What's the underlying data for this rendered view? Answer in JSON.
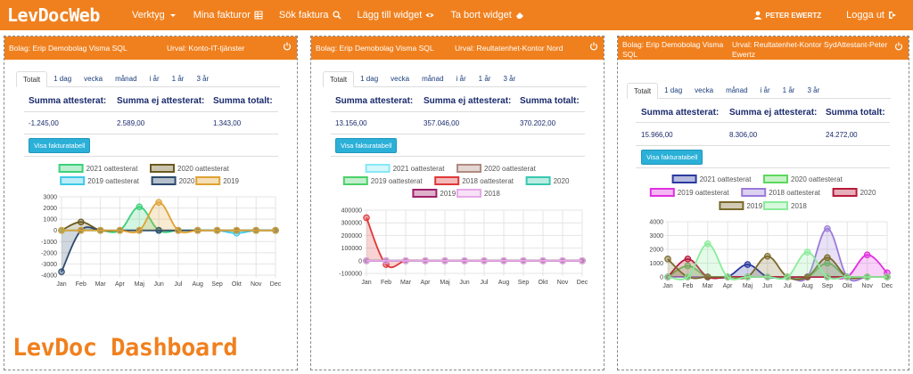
{
  "app": {
    "brand": "LevDocWeb",
    "dashboard_title": "LevDoc Dashboard"
  },
  "nav": {
    "items": [
      {
        "label": "Verktyg",
        "icon": "caret-down-icon"
      },
      {
        "label": "Mina fakturor",
        "icon": "table-icon"
      },
      {
        "label": "Sök faktura",
        "icon": "search-icon"
      },
      {
        "label": "Lägg till widget",
        "icon": "eye-icon"
      },
      {
        "label": "Ta bort widget",
        "icon": "eraser-icon"
      }
    ],
    "user": "PETER EWERTZ",
    "logout": "Logga ut"
  },
  "colors": {
    "accent": "#f0801e",
    "button": "#2bb0d8",
    "heading": "#1a2a6c"
  },
  "tabs": [
    "Totalt",
    "1 dag",
    "vecka",
    "månad",
    "i år",
    "1 år",
    "3 år"
  ],
  "labels": {
    "sum_attested": "Summa attesterat:",
    "sum_not_attested": "Summa ej attesterat:",
    "sum_total": "Summa totalt:",
    "show_table": "Visa fakturatabell"
  },
  "panels": [
    {
      "bolag": "Bolag: Erip Demobolag Visma SQL",
      "urval": "Urval: Konto-IT-tjänster",
      "attested": "-1.245,00",
      "not_attested": "2.589,00",
      "total": "1.343,00"
    },
    {
      "bolag": "Bolag: Erip Demobolag Visma SQL",
      "urval": "Urval: Reultatenhet-Kontor Nord",
      "attested": "13.156,00",
      "not_attested": "357.046,00",
      "total": "370.202,00"
    },
    {
      "bolag": "Bolag: Erip Demobolag Visma SQL",
      "urval": "Urval: Reultatenhet-Kontor SydAttestant-Peter Ewertz",
      "attested": "15.966,00",
      "not_attested": "8.306,00",
      "total": "24.272,00"
    }
  ],
  "chart_data": [
    {
      "type": "area",
      "categories": [
        "Jan",
        "Feb",
        "Mar",
        "Apr",
        "Maj",
        "Jun",
        "Jul",
        "Aug",
        "Sep",
        "Okt",
        "Nov",
        "Dec"
      ],
      "ylim": [
        -4000,
        3000
      ],
      "yticks": [
        3000,
        2000,
        1000,
        0,
        -1000,
        -2000,
        -3000,
        -4000
      ],
      "series": [
        {
          "name": "2021 oattesterat",
          "color": "#3dd07a",
          "values": [
            0,
            0,
            0,
            0,
            2100,
            0,
            0,
            0,
            0,
            0,
            0,
            0
          ]
        },
        {
          "name": "2020 oattesterat",
          "color": "#6b5a1e",
          "values": [
            0,
            750,
            0,
            0,
            0,
            0,
            0,
            0,
            0,
            0,
            0,
            0
          ]
        },
        {
          "name": "2019 oattesterat",
          "color": "#3fc9e8",
          "values": [
            0,
            0,
            0,
            0,
            0,
            0,
            0,
            0,
            0,
            -250,
            0,
            0
          ]
        },
        {
          "name": "2020",
          "color": "#2c4a6e",
          "values": [
            -3700,
            0,
            0,
            0,
            0,
            0,
            0,
            0,
            0,
            0,
            0,
            0
          ]
        },
        {
          "name": "2019",
          "color": "#e0a232",
          "values": [
            0,
            0,
            0,
            0,
            0,
            2500,
            0,
            0,
            0,
            0,
            0,
            0
          ]
        }
      ]
    },
    {
      "type": "area",
      "categories": [
        "Jan",
        "Feb",
        "Mar",
        "Apr",
        "Maj",
        "Jun",
        "Jul",
        "Aug",
        "Sep",
        "Okt",
        "Nov",
        "Dec"
      ],
      "ylim": [
        -100000,
        400000
      ],
      "yticks": [
        400000,
        300000,
        200000,
        100000,
        0,
        -100000
      ],
      "series": [
        {
          "name": "2021 oattesterat",
          "color": "#86e8f5",
          "values": [
            0,
            0,
            0,
            0,
            0,
            0,
            0,
            0,
            0,
            0,
            0,
            0
          ]
        },
        {
          "name": "2020 oattesterat",
          "color": "#b08a80",
          "values": [
            0,
            0,
            0,
            0,
            0,
            0,
            0,
            0,
            0,
            0,
            0,
            0
          ]
        },
        {
          "name": "2019 oattesterat",
          "color": "#4dd06a",
          "values": [
            0,
            0,
            0,
            0,
            0,
            0,
            0,
            0,
            0,
            0,
            0,
            0
          ]
        },
        {
          "name": "2018 oattesterat",
          "color": "#e03838",
          "values": [
            340000,
            -30000,
            0,
            0,
            0,
            0,
            0,
            0,
            0,
            0,
            0,
            0
          ]
        },
        {
          "name": "2020",
          "color": "#38c8b0",
          "values": [
            0,
            0,
            0,
            0,
            0,
            0,
            0,
            0,
            0,
            0,
            0,
            0
          ]
        },
        {
          "name": "2019",
          "color": "#a0206a",
          "values": [
            0,
            0,
            0,
            0,
            0,
            0,
            0,
            0,
            0,
            0,
            0,
            0
          ]
        },
        {
          "name": "2018",
          "color": "#e8a8e8",
          "values": [
            0,
            0,
            0,
            0,
            0,
            0,
            0,
            0,
            0,
            0,
            0,
            0
          ]
        }
      ]
    },
    {
      "type": "area",
      "categories": [
        "Jan",
        "Feb",
        "Mar",
        "Apr",
        "Maj",
        "Jun",
        "Jul",
        "Aug",
        "Sep",
        "Okt",
        "Nov",
        "Dec"
      ],
      "ylim": [
        0,
        4000
      ],
      "yticks": [
        4000,
        3000,
        2000,
        1000,
        0
      ],
      "series": [
        {
          "name": "2021 oattesterat",
          "color": "#2a3aa0",
          "values": [
            0,
            0,
            0,
            0,
            900,
            0,
            0,
            0,
            0,
            0,
            0,
            0
          ]
        },
        {
          "name": "2020 oattesterat",
          "color": "#5ed85e",
          "values": [
            0,
            800,
            0,
            0,
            0,
            0,
            0,
            0,
            1000,
            0,
            0,
            0
          ]
        },
        {
          "name": "2019 oattesterat",
          "color": "#e030e0",
          "values": [
            0,
            0,
            0,
            0,
            0,
            0,
            0,
            0,
            0,
            0,
            1600,
            300
          ]
        },
        {
          "name": "2018 oattesterat",
          "color": "#9a7ad8",
          "values": [
            0,
            0,
            0,
            0,
            0,
            0,
            0,
            0,
            3500,
            0,
            0,
            0
          ]
        },
        {
          "name": "2020",
          "color": "#b8183a",
          "values": [
            0,
            1300,
            0,
            0,
            0,
            0,
            0,
            0,
            0,
            0,
            0,
            0
          ]
        },
        {
          "name": "2019",
          "color": "#7a6a2a",
          "values": [
            1300,
            0,
            0,
            0,
            0,
            1500,
            0,
            0,
            1400,
            0,
            0,
            0
          ]
        },
        {
          "name": "2018",
          "color": "#8aec9a",
          "values": [
            0,
            0,
            2400,
            0,
            0,
            0,
            0,
            1800,
            0,
            0,
            0,
            0
          ]
        }
      ]
    }
  ]
}
